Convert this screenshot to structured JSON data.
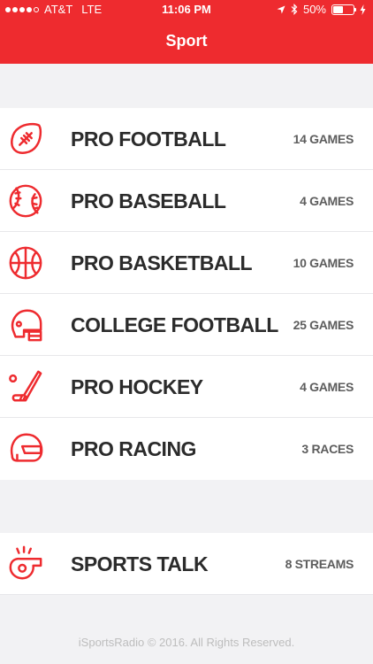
{
  "status_bar": {
    "carrier": "AT&T",
    "network": "LTE",
    "time": "11:06 PM",
    "battery_percent_text": "50%",
    "battery_fraction": 0.5
  },
  "header": {
    "title": "Sport"
  },
  "sports": [
    {
      "icon": "football-icon",
      "label": "PRO FOOTBALL",
      "count": "14 GAMES"
    },
    {
      "icon": "baseball-icon",
      "label": "PRO BASEBALL",
      "count": "4 GAMES"
    },
    {
      "icon": "basketball-icon",
      "label": "PRO BASKETBALL",
      "count": "10 GAMES"
    },
    {
      "icon": "football-helmet-icon",
      "label": "COLLEGE FOOTBALL",
      "count": "25 GAMES"
    },
    {
      "icon": "hockey-stick-icon",
      "label": "PRO HOCKEY",
      "count": "4 GAMES"
    },
    {
      "icon": "racing-helmet-icon",
      "label": "PRO RACING",
      "count": "3 RACES"
    }
  ],
  "talk": {
    "icon": "whistle-icon",
    "label": "SPORTS TALK",
    "count": "8 STREAMS"
  },
  "footer": {
    "text": "iSportsRadio © 2016. All Rights Reserved."
  },
  "colors": {
    "accent": "#ee2b2f",
    "background": "#f2f2f4"
  }
}
